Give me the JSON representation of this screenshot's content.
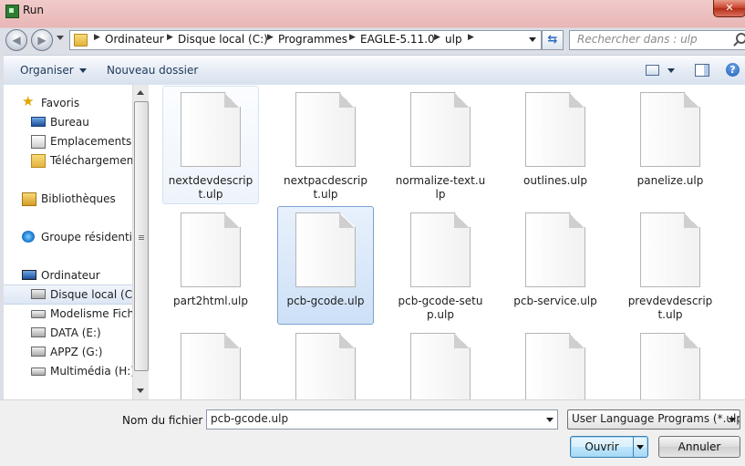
{
  "window": {
    "title": "Run",
    "close_glyph": "✕"
  },
  "address": {
    "crumbs": [
      "Ordinateur",
      "Disque local (C:)",
      "Programmes",
      "EAGLE-5.11.0",
      "ulp"
    ],
    "search_placeholder": "Rechercher dans : ulp"
  },
  "toolbar": {
    "organize": "Organiser",
    "new_folder": "Nouveau dossier",
    "help": "?"
  },
  "nav": {
    "favorites": "Favoris",
    "desktop": "Bureau",
    "recent": "Emplacements ré",
    "downloads": "Téléchargements",
    "libraries": "Bibliothèques",
    "homegroup": "Groupe résidentiel",
    "computer": "Ordinateur",
    "drive_c": "Disque local (C:)",
    "drive_modelisme": "Modelisme Fichie",
    "drive_data": "DATA (E:)",
    "drive_appz": "APPZ (G:)",
    "drive_multimedia": "Multimédia (H:)"
  },
  "files": [
    {
      "name": "nextdevdescript.ulp",
      "state": "hover"
    },
    {
      "name": "nextpacdescript.ulp",
      "state": ""
    },
    {
      "name": "normalize-text.ulp",
      "state": ""
    },
    {
      "name": "outlines.ulp",
      "state": ""
    },
    {
      "name": "panelize.ulp",
      "state": ""
    },
    {
      "name": "part2html.ulp",
      "state": ""
    },
    {
      "name": "pcb-gcode.ulp",
      "state": "selected"
    },
    {
      "name": "pcb-gcode-setup.ulp",
      "state": ""
    },
    {
      "name": "pcb-service.ulp",
      "state": ""
    },
    {
      "name": "prevdevdescript.ulp",
      "state": ""
    },
    {
      "name": "",
      "state": ""
    },
    {
      "name": "",
      "state": ""
    },
    {
      "name": "",
      "state": ""
    },
    {
      "name": "",
      "state": ""
    },
    {
      "name": "",
      "state": ""
    }
  ],
  "footer": {
    "filename_label": "Nom du fichier :",
    "filename_value": "pcb-gcode.ulp",
    "filetype_value": "User Language Programs (*.ulp",
    "open_label": "Ouvrir",
    "cancel_label": "Annuler"
  },
  "colors": {
    "accent": "#1e395b",
    "selection": "#cde0f7",
    "title_tint": "#e8b6b6"
  }
}
